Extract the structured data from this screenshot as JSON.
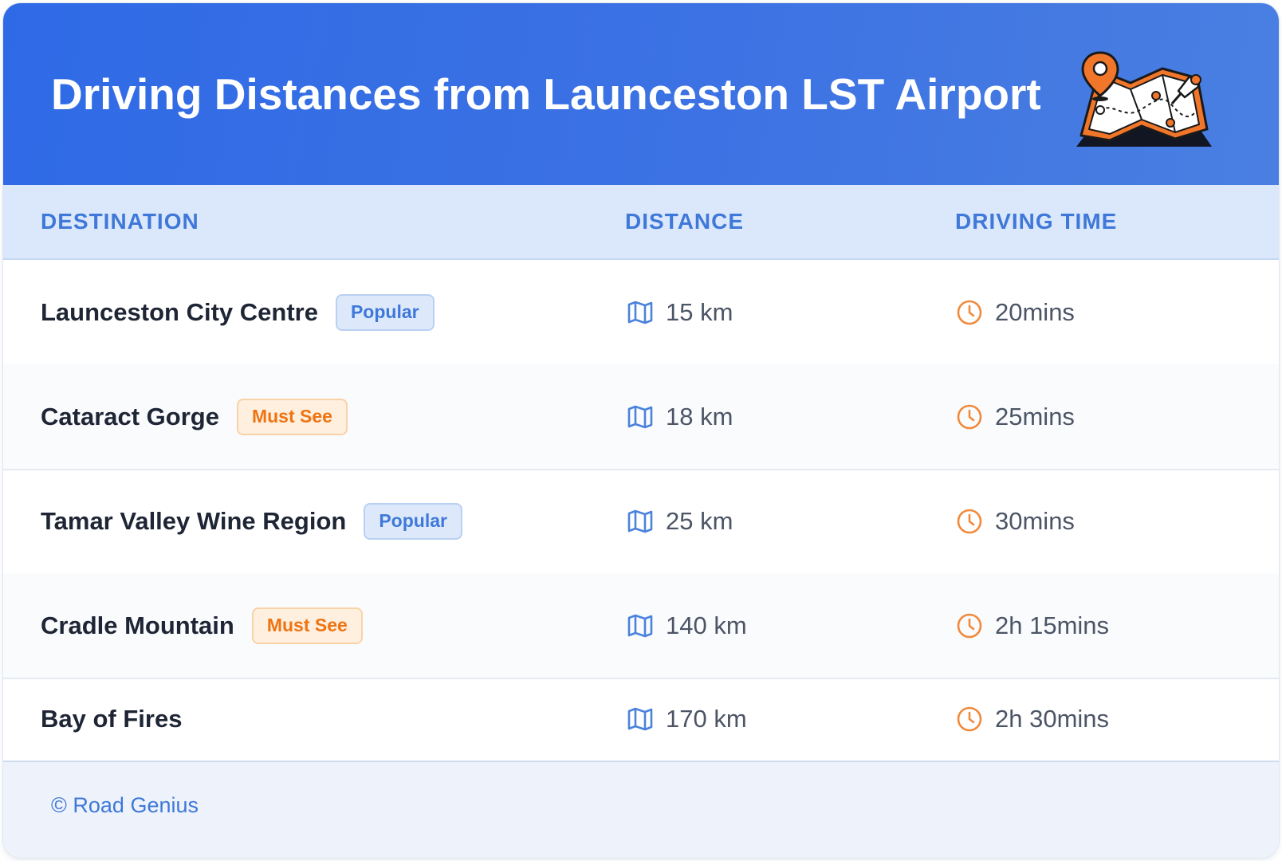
{
  "header": {
    "title": "Driving Distances from Launceston LST Airport",
    "illustration": "map-with-pins-illustration"
  },
  "table": {
    "columns": [
      "DESTINATION",
      "DISTANCE",
      "DRIVING TIME"
    ],
    "rows": [
      {
        "destination": "Launceston City Centre",
        "badge": "Popular",
        "badge_type": "popular",
        "distance": "15 km",
        "time": "20mins"
      },
      {
        "destination": "Cataract Gorge",
        "badge": "Must See",
        "badge_type": "mustsee",
        "distance": "18 km",
        "time": "25mins"
      },
      {
        "destination": "Tamar Valley Wine Region",
        "badge": "Popular",
        "badge_type": "popular",
        "distance": "25 km",
        "time": "30mins"
      },
      {
        "destination": "Cradle Mountain",
        "badge": "Must See",
        "badge_type": "mustsee",
        "distance": "140 km",
        "time": "2h 15mins"
      },
      {
        "destination": "Bay of Fires",
        "badge": "",
        "badge_type": "",
        "distance": "170 km",
        "time": "2h 30mins"
      }
    ],
    "distance_icon": "map-icon",
    "time_icon": "clock-icon"
  },
  "footer": {
    "copyright": "© Road Genius"
  },
  "colors": {
    "header_gradient_start": "#2f6ae6",
    "header_gradient_end": "#4a7fe2",
    "accent_blue": "#3f78d8",
    "accent_orange": "#ef7411",
    "table_head_bg": "#dbe8fb",
    "footer_bg": "#eef3fb"
  }
}
